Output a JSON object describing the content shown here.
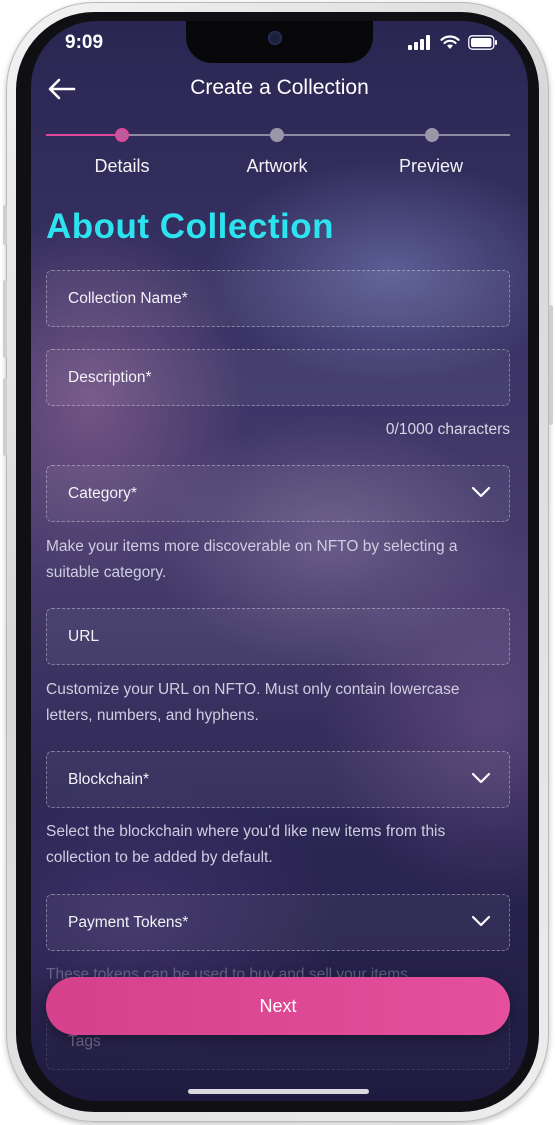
{
  "status_bar": {
    "time": "9:09",
    "icons": [
      "signal-icon",
      "wifi-icon",
      "battery-icon"
    ]
  },
  "header": {
    "title": "Create a Collection",
    "back_icon": "arrow-left-icon"
  },
  "stepper": {
    "steps": [
      {
        "label": "Details",
        "active": true
      },
      {
        "label": "Artwork",
        "active": false
      },
      {
        "label": "Preview",
        "active": false
      }
    ]
  },
  "section_title": "About Collection",
  "form": {
    "collection_name": {
      "placeholder": "Collection Name*"
    },
    "description": {
      "placeholder": "Description*",
      "char_count": "0/1000 characters"
    },
    "category": {
      "placeholder": "Category*",
      "helper": "Make your items more discoverable on NFTO by selecting a suitable category."
    },
    "url": {
      "placeholder": "URL",
      "helper": "Customize your URL on NFTO. Must only contain lowercase letters, numbers, and hyphens."
    },
    "blockchain": {
      "placeholder": "Blockchain*",
      "helper": "Select the blockchain where you'd like new items from this collection to be added by default."
    },
    "payment_tokens": {
      "placeholder": "Payment Tokens*",
      "helper": "These tokens can be used to buy and sell your items."
    },
    "tags": {
      "placeholder": "Tags"
    }
  },
  "next_button": "Next",
  "colors": {
    "accent_cyan": "#2ce3ef",
    "accent_pink": "#e0489a",
    "background": "#3b3466"
  }
}
